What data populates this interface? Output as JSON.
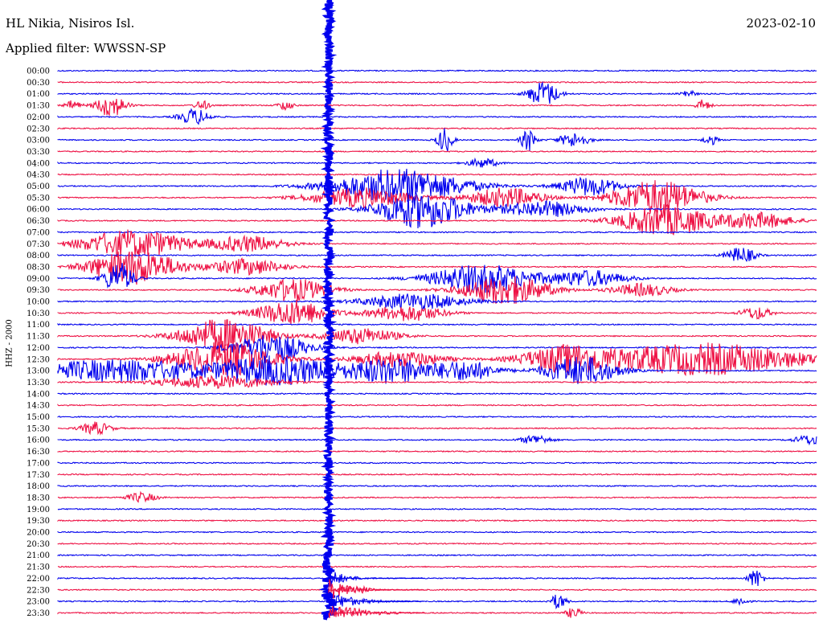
{
  "header": {
    "station": "HL Nikia, Nisiros Isl.",
    "filter": "Applied filter: WWSSN-SP",
    "date": "2023-02-10"
  },
  "chart_data": {
    "type": "line",
    "title": "HL Nikia, Nisiros Isl.",
    "subtitle": "Applied filter: WWSSN-SP",
    "ylabel": "HHZ - 2000",
    "date": "2023-02-10",
    "row_minutes": 30,
    "colors": {
      "odd": "#0000ee",
      "even": "#ee1144"
    },
    "rows": [
      "00:00",
      "00:30",
      "01:00",
      "01:30",
      "02:00",
      "02:30",
      "03:00",
      "03:30",
      "04:00",
      "04:30",
      "05:00",
      "05:30",
      "06:00",
      "06:30",
      "07:00",
      "07:30",
      "08:00",
      "08:30",
      "09:00",
      "09:30",
      "10:00",
      "10:30",
      "11:00",
      "11:30",
      "12:00",
      "12:30",
      "13:00",
      "13:30",
      "14:00",
      "14:30",
      "15:00",
      "15:30",
      "16:00",
      "16:30",
      "17:00",
      "17:30",
      "18:00",
      "18:30",
      "19:00",
      "19:30",
      "20:00",
      "20:30",
      "21:00",
      "21:30",
      "22:00",
      "22:30",
      "23:00",
      "23:30"
    ],
    "events": [
      {
        "row": 2,
        "t": 0.64,
        "amp": 16,
        "dur": 0.02
      },
      {
        "row": 2,
        "t": 0.83,
        "amp": 5,
        "dur": 0.01
      },
      {
        "row": 3,
        "t": 0.02,
        "amp": 6,
        "dur": 0.01
      },
      {
        "row": 3,
        "t": 0.07,
        "amp": 14,
        "dur": 0.02
      },
      {
        "row": 3,
        "t": 0.19,
        "amp": 6,
        "dur": 0.01
      },
      {
        "row": 3,
        "t": 0.3,
        "amp": 6,
        "dur": 0.01
      },
      {
        "row": 3,
        "t": 0.85,
        "amp": 7,
        "dur": 0.01
      },
      {
        "row": 4,
        "t": 0.18,
        "amp": 10,
        "dur": 0.02
      },
      {
        "row": 6,
        "t": 0.51,
        "amp": 16,
        "dur": 0.01
      },
      {
        "row": 6,
        "t": 0.62,
        "amp": 14,
        "dur": 0.01
      },
      {
        "row": 6,
        "t": 0.68,
        "amp": 9,
        "dur": 0.02
      },
      {
        "row": 6,
        "t": 0.86,
        "amp": 6,
        "dur": 0.01
      },
      {
        "row": 8,
        "t": 0.56,
        "amp": 6,
        "dur": 0.02
      },
      {
        "row": 10,
        "t": 0.7,
        "amp": 12,
        "dur": 0.04
      },
      {
        "row": 10,
        "t": 0.45,
        "amp": 22,
        "dur": 0.09
      },
      {
        "row": 11,
        "t": 0.4,
        "amp": 12,
        "dur": 0.07
      },
      {
        "row": 11,
        "t": 0.59,
        "amp": 12,
        "dur": 0.05
      },
      {
        "row": 11,
        "t": 0.79,
        "amp": 22,
        "dur": 0.06
      },
      {
        "row": 12,
        "t": 0.48,
        "amp": 24,
        "dur": 0.06
      },
      {
        "row": 12,
        "t": 0.64,
        "amp": 10,
        "dur": 0.06
      },
      {
        "row": 13,
        "t": 0.8,
        "amp": 20,
        "dur": 0.06
      },
      {
        "row": 13,
        "t": 0.92,
        "amp": 10,
        "dur": 0.05
      },
      {
        "row": 15,
        "t": 0.1,
        "amp": 18,
        "dur": 0.07
      },
      {
        "row": 15,
        "t": 0.25,
        "amp": 10,
        "dur": 0.05
      },
      {
        "row": 16,
        "t": 0.9,
        "amp": 10,
        "dur": 0.02
      },
      {
        "row": 17,
        "t": 0.1,
        "amp": 22,
        "dur": 0.06
      },
      {
        "row": 17,
        "t": 0.25,
        "amp": 10,
        "dur": 0.05
      },
      {
        "row": 18,
        "t": 0.08,
        "amp": 20,
        "dur": 0.02
      },
      {
        "row": 18,
        "t": 0.56,
        "amp": 18,
        "dur": 0.07
      },
      {
        "row": 18,
        "t": 0.7,
        "amp": 10,
        "dur": 0.05
      },
      {
        "row": 19,
        "t": 0.31,
        "amp": 14,
        "dur": 0.05
      },
      {
        "row": 19,
        "t": 0.59,
        "amp": 18,
        "dur": 0.06
      },
      {
        "row": 19,
        "t": 0.77,
        "amp": 8,
        "dur": 0.04
      },
      {
        "row": 20,
        "t": 0.47,
        "amp": 10,
        "dur": 0.07
      },
      {
        "row": 21,
        "t": 0.31,
        "amp": 16,
        "dur": 0.05
      },
      {
        "row": 21,
        "t": 0.46,
        "amp": 10,
        "dur": 0.05
      },
      {
        "row": 21,
        "t": 0.92,
        "amp": 8,
        "dur": 0.02
      },
      {
        "row": 23,
        "t": 0.22,
        "amp": 22,
        "dur": 0.06
      },
      {
        "row": 23,
        "t": 0.4,
        "amp": 10,
        "dur": 0.05
      },
      {
        "row": 24,
        "t": 0.28,
        "amp": 18,
        "dur": 0.05
      },
      {
        "row": 25,
        "t": 0.22,
        "amp": 22,
        "dur": 0.07
      },
      {
        "row": 25,
        "t": 0.45,
        "amp": 10,
        "dur": 0.06
      },
      {
        "row": 25,
        "t": 0.67,
        "amp": 16,
        "dur": 0.06
      },
      {
        "row": 25,
        "t": 0.85,
        "amp": 20,
        "dur": 0.14
      },
      {
        "row": 26,
        "t": 0.08,
        "amp": 14,
        "dur": 0.13
      },
      {
        "row": 26,
        "t": 0.29,
        "amp": 18,
        "dur": 0.08
      },
      {
        "row": 26,
        "t": 0.44,
        "amp": 16,
        "dur": 0.06
      },
      {
        "row": 26,
        "t": 0.54,
        "amp": 12,
        "dur": 0.04
      },
      {
        "row": 26,
        "t": 0.69,
        "amp": 18,
        "dur": 0.05
      },
      {
        "row": 27,
        "t": 0.21,
        "amp": 8,
        "dur": 0.08
      },
      {
        "row": 31,
        "t": 0.05,
        "amp": 8,
        "dur": 0.02
      },
      {
        "row": 32,
        "t": 0.63,
        "amp": 6,
        "dur": 0.02
      },
      {
        "row": 32,
        "t": 0.99,
        "amp": 6,
        "dur": 0.02
      },
      {
        "row": 37,
        "t": 0.11,
        "amp": 6,
        "dur": 0.02
      },
      {
        "row": 44,
        "t": 0.92,
        "amp": 12,
        "dur": 0.01
      },
      {
        "row": 45,
        "t": 0.39,
        "amp": 6,
        "dur": 0.02
      },
      {
        "row": 46,
        "t": 0.66,
        "amp": 10,
        "dur": 0.01
      },
      {
        "row": 46,
        "t": 0.9,
        "amp": 5,
        "dur": 0.01
      },
      {
        "row": 47,
        "t": 0.68,
        "amp": 7,
        "dur": 0.01
      }
    ]
  }
}
